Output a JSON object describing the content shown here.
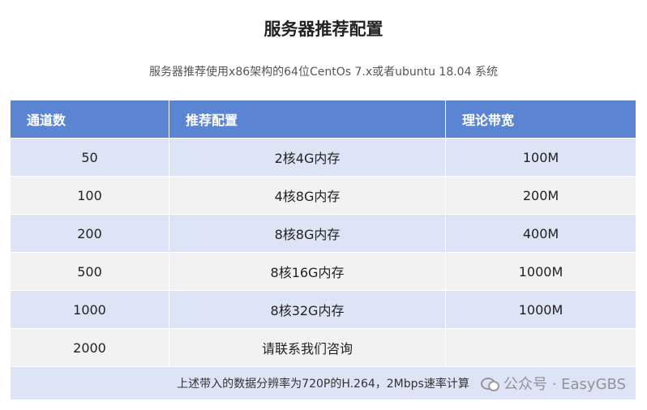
{
  "page": {
    "title": "服务器推荐配置",
    "subtitle": "服务器推荐使用x86架构的64位CentOs 7.x或者ubuntu 18.04 系统"
  },
  "table": {
    "headers": [
      "通道数",
      "推荐配置",
      "理论带宽"
    ],
    "rows": [
      [
        "50",
        "2核4G内存",
        "100M"
      ],
      [
        "100",
        "4核8G内存",
        "200M"
      ],
      [
        "200",
        "8核8G内存",
        "400M"
      ],
      [
        "500",
        "8核16G内存",
        "1000M"
      ],
      [
        "1000",
        "8核32G内存",
        "1000M"
      ],
      [
        "2000",
        "请联系我们咨询",
        ""
      ]
    ],
    "footnote": "上述带入的数据分辨率为720P的H.264，2Mbps速率计算"
  },
  "watermark": {
    "text": "公众号 · EasyGBS",
    "icon": "wechat-icon"
  },
  "colors": {
    "header_bg": "#5b85d3",
    "row_alt_bg": "#dce4f5",
    "row_plain_bg": "#f2f2f2"
  }
}
